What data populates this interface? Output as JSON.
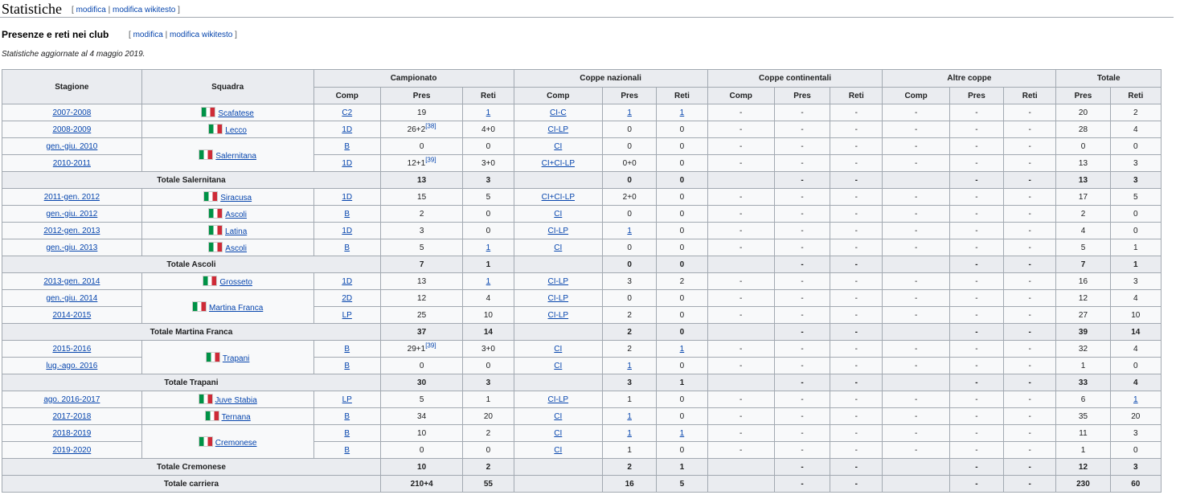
{
  "section": {
    "title": "Statistiche",
    "edit": {
      "open": "[",
      "edit": "modifica",
      "sep": "|",
      "source": "modifica wikitesto",
      "close": "]"
    }
  },
  "subsection": {
    "title": "Presenze e reti nei club",
    "edit": {
      "open": "[",
      "edit": "modifica",
      "sep": "|",
      "source": "modifica wikitesto",
      "close": "]"
    }
  },
  "note": "Statistiche aggiornate al 4 maggio 2019.",
  "headers": {
    "season": "Stagione",
    "team": "Squadra",
    "groups": [
      "Campionato",
      "Coppe nazionali",
      "Coppe continentali",
      "Altre coppe",
      "Totale"
    ],
    "comp": "Comp",
    "pres": "Pres",
    "reti": "Reti"
  },
  "table": {
    "rows": [
      [
        "2007-2008",
        "Scafatese",
        "C2",
        "19",
        "",
        "1",
        "CI-C",
        "1",
        "1",
        "-",
        "-",
        "-",
        "-",
        "-",
        "-",
        "20",
        "2"
      ],
      [
        "2008-2009",
        "Lecco",
        "1D",
        "26+2",
        "38",
        "4+0",
        "CI-LP",
        "0",
        "0",
        "-",
        "-",
        "-",
        "-",
        "-",
        "-",
        "28",
        "4"
      ],
      [
        "gen.-giu. 2010",
        "Salernitana",
        "B",
        "0",
        "",
        "0",
        "CI",
        "0",
        "0",
        "-",
        "-",
        "-",
        "-",
        "-",
        "-",
        "0",
        "0"
      ],
      [
        "2010-2011",
        "",
        "1D",
        "12+1",
        "39",
        "3+0",
        "CI+CI-LP",
        "0+0",
        "0",
        "-",
        "-",
        "-",
        "-",
        "-",
        "-",
        "13",
        "3"
      ],
      [
        "Totale Salernitana",
        "",
        "",
        "13",
        "",
        "3",
        "",
        "0",
        "0",
        "",
        "-",
        "-",
        "",
        "-",
        "-",
        "13",
        "3"
      ],
      [
        "2011-gen. 2012",
        "Siracusa",
        "1D",
        "15",
        "",
        "5",
        "CI+CI-LP",
        "2+0",
        "0",
        "-",
        "-",
        "-",
        "-",
        "-",
        "-",
        "17",
        "5"
      ],
      [
        "gen.-giu. 2012",
        "Ascoli",
        "B",
        "2",
        "",
        "0",
        "CI",
        "0",
        "0",
        "-",
        "-",
        "-",
        "-",
        "-",
        "-",
        "2",
        "0"
      ],
      [
        "2012-gen. 2013",
        "Latina",
        "1D",
        "3",
        "",
        "0",
        "CI-LP",
        "1",
        "0",
        "-",
        "-",
        "-",
        "-",
        "-",
        "-",
        "4",
        "0"
      ],
      [
        "gen.-giu. 2013",
        "Ascoli",
        "B",
        "5",
        "",
        "1",
        "CI",
        "0",
        "0",
        "-",
        "-",
        "-",
        "-",
        "-",
        "-",
        "5",
        "1"
      ],
      [
        "Totale Ascoli",
        "",
        "",
        "7",
        "",
        "1",
        "",
        "0",
        "0",
        "",
        "-",
        "-",
        "",
        "-",
        "-",
        "7",
        "1"
      ],
      [
        "2013-gen. 2014",
        "Grosseto",
        "1D",
        "13",
        "",
        "1",
        "CI-LP",
        "3",
        "2",
        "-",
        "-",
        "-",
        "-",
        "-",
        "-",
        "16",
        "3"
      ],
      [
        "gen.-giu. 2014",
        "Martina Franca",
        "2D",
        "12",
        "",
        "4",
        "CI-LP",
        "0",
        "0",
        "-",
        "-",
        "-",
        "-",
        "-",
        "-",
        "12",
        "4"
      ],
      [
        "2014-2015",
        "",
        "LP",
        "25",
        "",
        "10",
        "CI-LP",
        "2",
        "0",
        "-",
        "-",
        "-",
        "-",
        "-",
        "-",
        "27",
        "10"
      ],
      [
        "Totale Martina Franca",
        "",
        "",
        "37",
        "",
        "14",
        "",
        "2",
        "0",
        "",
        "-",
        "-",
        "",
        "-",
        "-",
        "39",
        "14"
      ],
      [
        "2015-2016",
        "Trapani",
        "B",
        "29+1",
        "39",
        "3+0",
        "CI",
        "2",
        "1",
        "-",
        "-",
        "-",
        "-",
        "-",
        "-",
        "32",
        "4"
      ],
      [
        "lug.-ago. 2016",
        "",
        "B",
        "0",
        "",
        "0",
        "CI",
        "1",
        "0",
        "-",
        "-",
        "-",
        "-",
        "-",
        "-",
        "1",
        "0"
      ],
      [
        "Totale Trapani",
        "",
        "",
        "30",
        "",
        "3",
        "",
        "3",
        "1",
        "",
        "-",
        "-",
        "",
        "-",
        "-",
        "33",
        "4"
      ],
      [
        "ago. 2016-2017",
        "Juve Stabia",
        "LP",
        "5",
        "",
        "1",
        "CI-LP",
        "1",
        "0",
        "-",
        "-",
        "-",
        "-",
        "-",
        "-",
        "6",
        "1"
      ],
      [
        "2017-2018",
        "Ternana",
        "B",
        "34",
        "",
        "20",
        "CI",
        "1",
        "0",
        "-",
        "-",
        "-",
        "-",
        "-",
        "-",
        "35",
        "20"
      ],
      [
        "2018-2019",
        "Cremonese",
        "B",
        "10",
        "",
        "2",
        "CI",
        "1",
        "1",
        "-",
        "-",
        "-",
        "-",
        "-",
        "-",
        "11",
        "3"
      ],
      [
        "2019-2020",
        "",
        "B",
        "0",
        "",
        "0",
        "CI",
        "1",
        "0",
        "-",
        "-",
        "-",
        "-",
        "-",
        "-",
        "1",
        "0"
      ],
      [
        "Totale Cremonese",
        "",
        "",
        "10",
        "",
        "2",
        "",
        "2",
        "1",
        "",
        "-",
        "-",
        "",
        "-",
        "-",
        "12",
        "3"
      ],
      [
        "Totale carriera",
        "",
        "",
        "210+4",
        "",
        "55",
        "",
        "16",
        "5",
        "",
        "-",
        "-",
        "",
        "-",
        "-",
        "230",
        "60"
      ]
    ]
  },
  "colors": {
    "link": "#0645ad",
    "header_bg": "#eaecf0",
    "cell_bg": "#f8f9fa",
    "border": "#a2a9b1"
  }
}
